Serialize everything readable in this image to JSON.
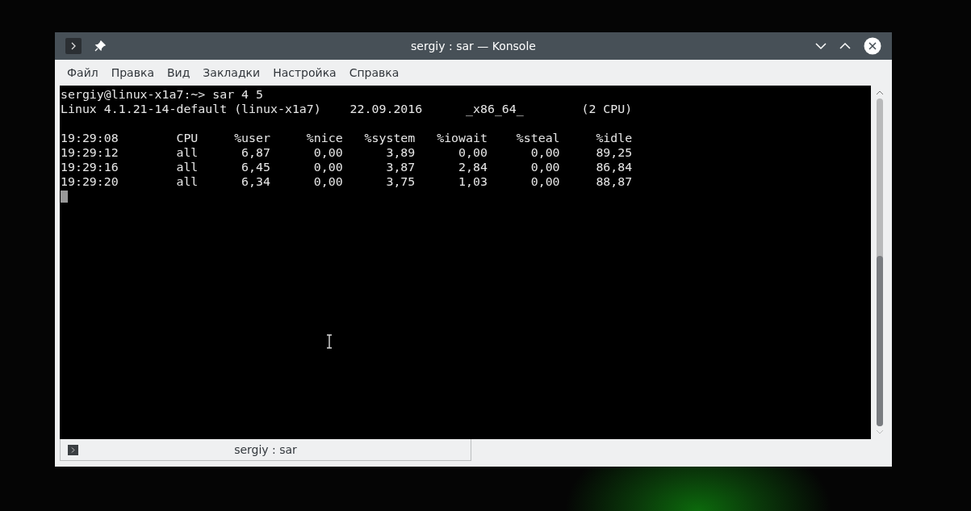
{
  "window": {
    "title": "sergiy : sar — Konsole"
  },
  "menu": [
    "Файл",
    "Правка",
    "Вид",
    "Закладки",
    "Настройка",
    "Справка"
  ],
  "terminal": {
    "blocks": [
      [
        "sergiy@linux-x1a7:~> sar 4 5",
        "Linux 4.1.21-14-default (linux-x1a7)    22.09.2016      _x86_64_        (2 CPU)"
      ],
      [
        "19:29:08        CPU     %user     %nice   %system   %iowait    %steal     %idle",
        "19:29:12        all      6,87      0,00      3,89      0,00      0,00     89,25",
        "19:29:16        all      6,45      0,00      3,87      2,84      0,00     86,84",
        "19:29:20        all      6,34      0,00      3,75      1,03      0,00     88,87"
      ]
    ]
  },
  "tabs": [
    {
      "label": "sergiy : sar",
      "selected": true
    }
  ]
}
